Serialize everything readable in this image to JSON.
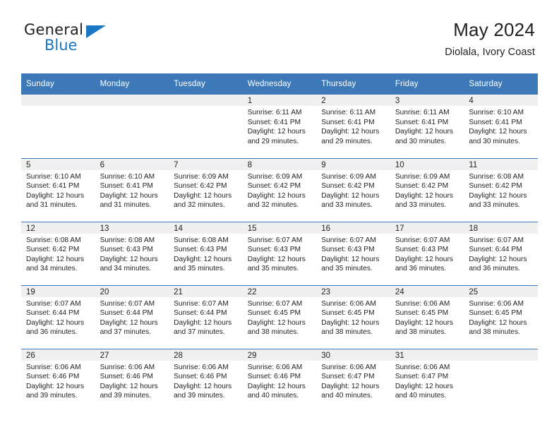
{
  "brand": {
    "name_top": "General",
    "name_bottom": "Blue",
    "accent_color": "#1b76c4"
  },
  "header": {
    "title": "May 2024",
    "subtitle": "Diolala, Ivory Coast",
    "header_bg": "#3d79b8",
    "daynum_bg": "#f0f0f0"
  },
  "weekday_headers": [
    "Sunday",
    "Monday",
    "Tuesday",
    "Wednesday",
    "Thursday",
    "Friday",
    "Saturday"
  ],
  "weeks": [
    [
      {
        "day": "",
        "empty": true,
        "sunrise": "",
        "sunset": "",
        "daylight_line1": "",
        "daylight_line2": ""
      },
      {
        "day": "",
        "empty": true,
        "sunrise": "",
        "sunset": "",
        "daylight_line1": "",
        "daylight_line2": ""
      },
      {
        "day": "",
        "empty": true,
        "sunrise": "",
        "sunset": "",
        "daylight_line1": "",
        "daylight_line2": ""
      },
      {
        "day": "1",
        "empty": false,
        "sunrise": "Sunrise: 6:11 AM",
        "sunset": "Sunset: 6:41 PM",
        "daylight_line1": "Daylight: 12 hours",
        "daylight_line2": "and 29 minutes."
      },
      {
        "day": "2",
        "empty": false,
        "sunrise": "Sunrise: 6:11 AM",
        "sunset": "Sunset: 6:41 PM",
        "daylight_line1": "Daylight: 12 hours",
        "daylight_line2": "and 29 minutes."
      },
      {
        "day": "3",
        "empty": false,
        "sunrise": "Sunrise: 6:11 AM",
        "sunset": "Sunset: 6:41 PM",
        "daylight_line1": "Daylight: 12 hours",
        "daylight_line2": "and 30 minutes."
      },
      {
        "day": "4",
        "empty": false,
        "sunrise": "Sunrise: 6:10 AM",
        "sunset": "Sunset: 6:41 PM",
        "daylight_line1": "Daylight: 12 hours",
        "daylight_line2": "and 30 minutes."
      }
    ],
    [
      {
        "day": "5",
        "empty": false,
        "sunrise": "Sunrise: 6:10 AM",
        "sunset": "Sunset: 6:41 PM",
        "daylight_line1": "Daylight: 12 hours",
        "daylight_line2": "and 31 minutes."
      },
      {
        "day": "6",
        "empty": false,
        "sunrise": "Sunrise: 6:10 AM",
        "sunset": "Sunset: 6:41 PM",
        "daylight_line1": "Daylight: 12 hours",
        "daylight_line2": "and 31 minutes."
      },
      {
        "day": "7",
        "empty": false,
        "sunrise": "Sunrise: 6:09 AM",
        "sunset": "Sunset: 6:42 PM",
        "daylight_line1": "Daylight: 12 hours",
        "daylight_line2": "and 32 minutes."
      },
      {
        "day": "8",
        "empty": false,
        "sunrise": "Sunrise: 6:09 AM",
        "sunset": "Sunset: 6:42 PM",
        "daylight_line1": "Daylight: 12 hours",
        "daylight_line2": "and 32 minutes."
      },
      {
        "day": "9",
        "empty": false,
        "sunrise": "Sunrise: 6:09 AM",
        "sunset": "Sunset: 6:42 PM",
        "daylight_line1": "Daylight: 12 hours",
        "daylight_line2": "and 33 minutes."
      },
      {
        "day": "10",
        "empty": false,
        "sunrise": "Sunrise: 6:09 AM",
        "sunset": "Sunset: 6:42 PM",
        "daylight_line1": "Daylight: 12 hours",
        "daylight_line2": "and 33 minutes."
      },
      {
        "day": "11",
        "empty": false,
        "sunrise": "Sunrise: 6:08 AM",
        "sunset": "Sunset: 6:42 PM",
        "daylight_line1": "Daylight: 12 hours",
        "daylight_line2": "and 33 minutes."
      }
    ],
    [
      {
        "day": "12",
        "empty": false,
        "sunrise": "Sunrise: 6:08 AM",
        "sunset": "Sunset: 6:42 PM",
        "daylight_line1": "Daylight: 12 hours",
        "daylight_line2": "and 34 minutes."
      },
      {
        "day": "13",
        "empty": false,
        "sunrise": "Sunrise: 6:08 AM",
        "sunset": "Sunset: 6:43 PM",
        "daylight_line1": "Daylight: 12 hours",
        "daylight_line2": "and 34 minutes."
      },
      {
        "day": "14",
        "empty": false,
        "sunrise": "Sunrise: 6:08 AM",
        "sunset": "Sunset: 6:43 PM",
        "daylight_line1": "Daylight: 12 hours",
        "daylight_line2": "and 35 minutes."
      },
      {
        "day": "15",
        "empty": false,
        "sunrise": "Sunrise: 6:07 AM",
        "sunset": "Sunset: 6:43 PM",
        "daylight_line1": "Daylight: 12 hours",
        "daylight_line2": "and 35 minutes."
      },
      {
        "day": "16",
        "empty": false,
        "sunrise": "Sunrise: 6:07 AM",
        "sunset": "Sunset: 6:43 PM",
        "daylight_line1": "Daylight: 12 hours",
        "daylight_line2": "and 35 minutes."
      },
      {
        "day": "17",
        "empty": false,
        "sunrise": "Sunrise: 6:07 AM",
        "sunset": "Sunset: 6:43 PM",
        "daylight_line1": "Daylight: 12 hours",
        "daylight_line2": "and 36 minutes."
      },
      {
        "day": "18",
        "empty": false,
        "sunrise": "Sunrise: 6:07 AM",
        "sunset": "Sunset: 6:44 PM",
        "daylight_line1": "Daylight: 12 hours",
        "daylight_line2": "and 36 minutes."
      }
    ],
    [
      {
        "day": "19",
        "empty": false,
        "sunrise": "Sunrise: 6:07 AM",
        "sunset": "Sunset: 6:44 PM",
        "daylight_line1": "Daylight: 12 hours",
        "daylight_line2": "and 36 minutes."
      },
      {
        "day": "20",
        "empty": false,
        "sunrise": "Sunrise: 6:07 AM",
        "sunset": "Sunset: 6:44 PM",
        "daylight_line1": "Daylight: 12 hours",
        "daylight_line2": "and 37 minutes."
      },
      {
        "day": "21",
        "empty": false,
        "sunrise": "Sunrise: 6:07 AM",
        "sunset": "Sunset: 6:44 PM",
        "daylight_line1": "Daylight: 12 hours",
        "daylight_line2": "and 37 minutes."
      },
      {
        "day": "22",
        "empty": false,
        "sunrise": "Sunrise: 6:07 AM",
        "sunset": "Sunset: 6:45 PM",
        "daylight_line1": "Daylight: 12 hours",
        "daylight_line2": "and 38 minutes."
      },
      {
        "day": "23",
        "empty": false,
        "sunrise": "Sunrise: 6:06 AM",
        "sunset": "Sunset: 6:45 PM",
        "daylight_line1": "Daylight: 12 hours",
        "daylight_line2": "and 38 minutes."
      },
      {
        "day": "24",
        "empty": false,
        "sunrise": "Sunrise: 6:06 AM",
        "sunset": "Sunset: 6:45 PM",
        "daylight_line1": "Daylight: 12 hours",
        "daylight_line2": "and 38 minutes."
      },
      {
        "day": "25",
        "empty": false,
        "sunrise": "Sunrise: 6:06 AM",
        "sunset": "Sunset: 6:45 PM",
        "daylight_line1": "Daylight: 12 hours",
        "daylight_line2": "and 38 minutes."
      }
    ],
    [
      {
        "day": "26",
        "empty": false,
        "sunrise": "Sunrise: 6:06 AM",
        "sunset": "Sunset: 6:46 PM",
        "daylight_line1": "Daylight: 12 hours",
        "daylight_line2": "and 39 minutes."
      },
      {
        "day": "27",
        "empty": false,
        "sunrise": "Sunrise: 6:06 AM",
        "sunset": "Sunset: 6:46 PM",
        "daylight_line1": "Daylight: 12 hours",
        "daylight_line2": "and 39 minutes."
      },
      {
        "day": "28",
        "empty": false,
        "sunrise": "Sunrise: 6:06 AM",
        "sunset": "Sunset: 6:46 PM",
        "daylight_line1": "Daylight: 12 hours",
        "daylight_line2": "and 39 minutes."
      },
      {
        "day": "29",
        "empty": false,
        "sunrise": "Sunrise: 6:06 AM",
        "sunset": "Sunset: 6:46 PM",
        "daylight_line1": "Daylight: 12 hours",
        "daylight_line2": "and 40 minutes."
      },
      {
        "day": "30",
        "empty": false,
        "sunrise": "Sunrise: 6:06 AM",
        "sunset": "Sunset: 6:47 PM",
        "daylight_line1": "Daylight: 12 hours",
        "daylight_line2": "and 40 minutes."
      },
      {
        "day": "31",
        "empty": false,
        "sunrise": "Sunrise: 6:06 AM",
        "sunset": "Sunset: 6:47 PM",
        "daylight_line1": "Daylight: 12 hours",
        "daylight_line2": "and 40 minutes."
      },
      {
        "day": "",
        "empty": true,
        "sunrise": "",
        "sunset": "",
        "daylight_line1": "",
        "daylight_line2": ""
      }
    ]
  ]
}
